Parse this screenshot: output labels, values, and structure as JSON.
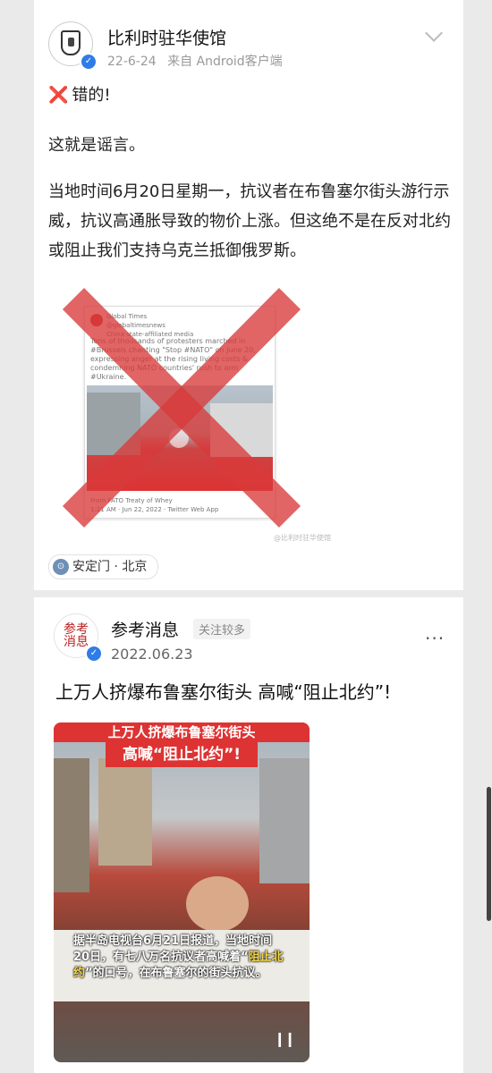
{
  "post1": {
    "author": "比利时驻华使馆",
    "date": "22-6-24",
    "source": "来自 Android客户端",
    "verdict_mark": "❌",
    "verdict": "错的!",
    "line1": "这就是谣言。",
    "body": "当地时间6月20日星期一，抗议者在布鲁塞尔街头游行示威，抗议高通胀导致的物价上涨。但这绝不是在反对北约或阻止我们支持乌克兰抵御俄罗斯。",
    "location": "安定门 · 北京",
    "embed": {
      "account_name": "Global Times",
      "account_handle": "@globaltimesnews",
      "account_label": "China state-affiliated media",
      "tweet_text": "Tens of thousands of protesters marched in #Brussels chanting \"Stop #NATO\" on June 20, expressing anger at the rising living costs & condemning NATO countries' rush to arm #Ukraine.",
      "credit": "From FATO Treaty of Whey",
      "time": "1:21 AM · Jun 22, 2022 · Twitter Web App",
      "watermark": "@比利时驻华使馆"
    }
  },
  "post2": {
    "author": "参考消息",
    "follow_tag": "关注较多",
    "date": "2022.06.23",
    "avatar_text": "参考消息",
    "title": "上万人挤爆布鲁塞尔街头 高喊“阻止北约”!",
    "video": {
      "headline1": "上万人挤爆布鲁塞尔街头",
      "headline2": "高喊“阻止北约”!",
      "caption_a": "据半岛电视台6月21日报道，当地时间20日，有七八万名抗议者高喊着“",
      "caption_hl": "阻止北约",
      "caption_b": "”的口号，在布鲁塞尔的街头抗议。",
      "pause_icon": "pause-icon"
    }
  },
  "colors": {
    "cross": "#d93a3a",
    "verified": "#2f7ce6",
    "video_banner": "#dd3333",
    "caption_highlight": "#f6d64a"
  }
}
